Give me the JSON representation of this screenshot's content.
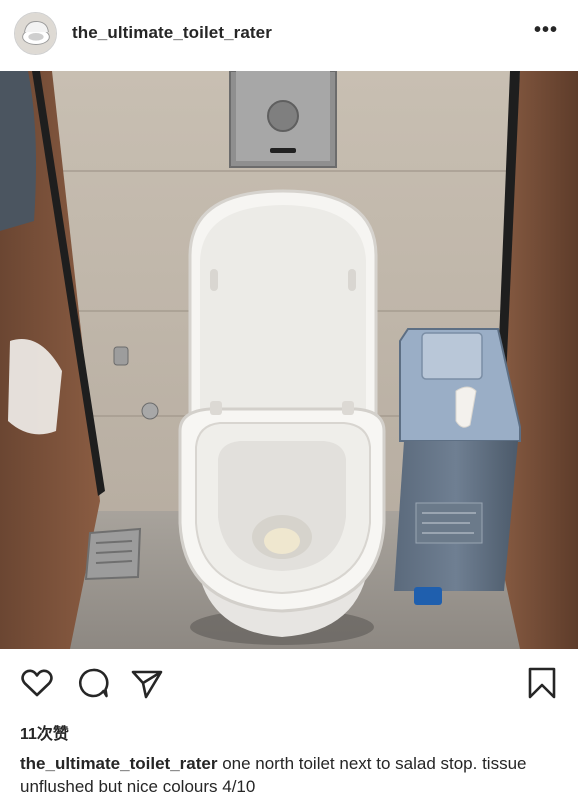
{
  "post": {
    "username": "the_ultimate_toilet_rater",
    "more_label": "•••",
    "likes_text": "11次赞",
    "caption_user": "the_ultimate_toilet_rater",
    "caption_text": "one north toilet next to salad stop. tissue unflushed but nice colours 4/10"
  },
  "icons": {
    "avatar": "toilet-avatar",
    "like": "heart-icon",
    "comment": "comment-icon",
    "share": "send-icon",
    "save": "bookmark-icon",
    "more": "more-icon"
  },
  "colors": {
    "text": "#262626",
    "background": "#ffffff"
  }
}
